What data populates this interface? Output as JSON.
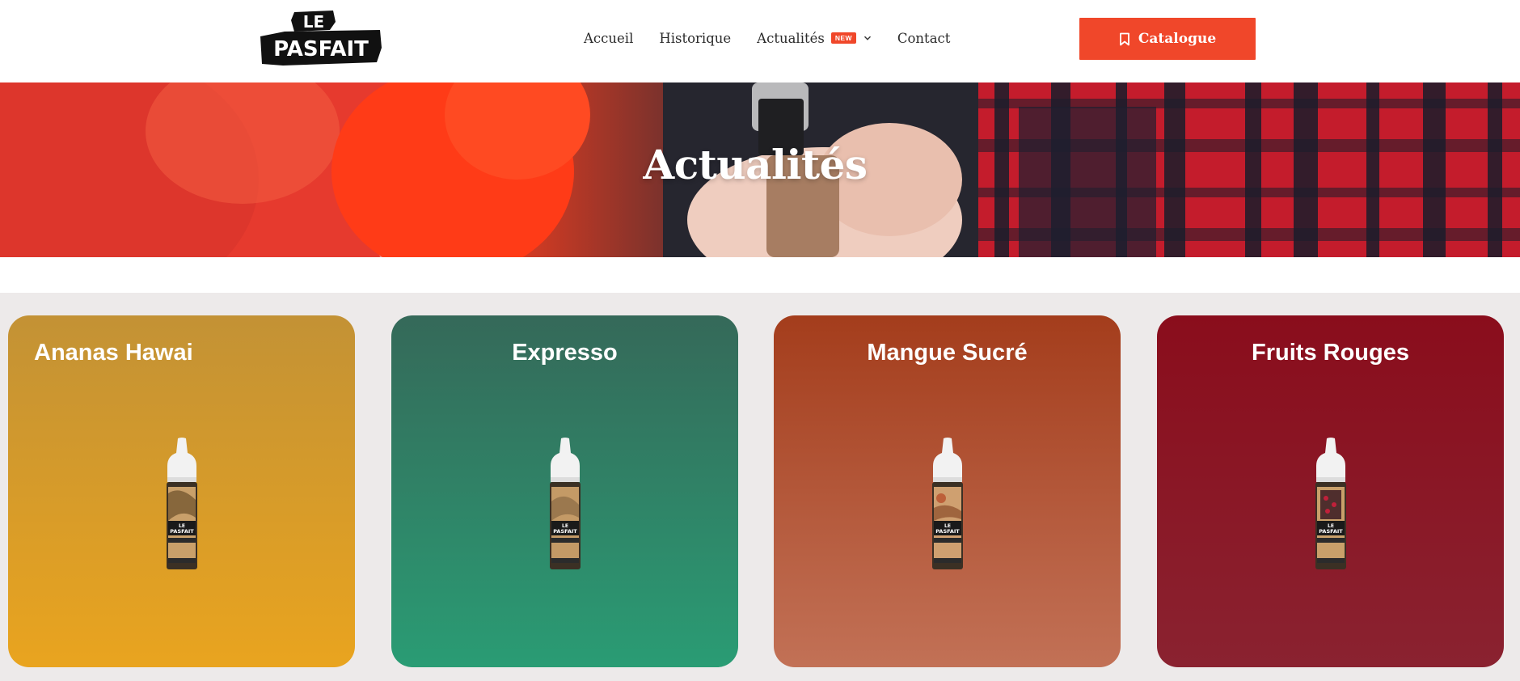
{
  "header": {
    "logo_text": "LE PASFAIT",
    "nav": [
      {
        "label": "Accueil"
      },
      {
        "label": "Historique"
      },
      {
        "label": "Actualités",
        "badge": "NEW",
        "has_dropdown": true
      },
      {
        "label": "Contact"
      }
    ],
    "cta": {
      "label": "Catalogue",
      "icon": "bookmark-icon"
    }
  },
  "hero": {
    "title": "Actualités"
  },
  "cards": [
    {
      "title": "Ananas Hawai",
      "bottle_label": "LE PASFAIT",
      "colors": {
        "top": "#c39235",
        "bottom": "#e9a41f"
      }
    },
    {
      "title": "Expresso",
      "bottle_label": "LE PASFAIT",
      "colors": {
        "top": "#356959",
        "bottom": "#2a9c74"
      }
    },
    {
      "title": "Mangue Sucré",
      "bottle_label": "LE PASFAIT",
      "colors": {
        "top": "#a43d1c",
        "bottom": "#c27156"
      }
    },
    {
      "title": "Fruits Rouges",
      "bottle_label": "LE PASFAIT",
      "colors": {
        "top": "#8a0d1c",
        "bottom": "#8a2230"
      }
    }
  ],
  "colors": {
    "accent": "#f0472a",
    "page_bg": "#edeaea"
  }
}
